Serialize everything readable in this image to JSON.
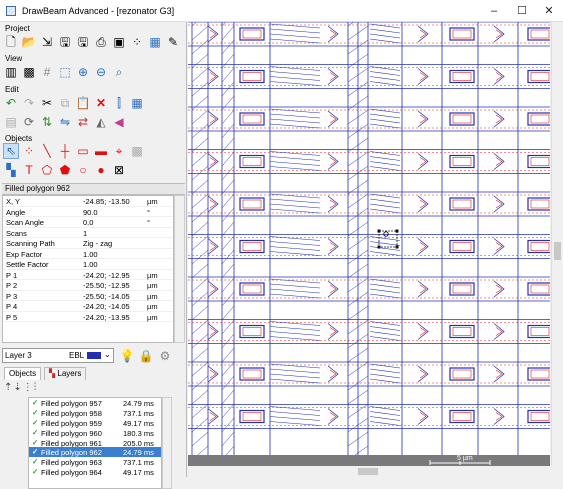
{
  "window": {
    "title": "DrawBeam Advanced - [rezonator G3]",
    "minimize": "–",
    "maximize": "☐",
    "close": "✕"
  },
  "sections": {
    "project": "Project",
    "view": "View",
    "edit": "Edit",
    "objects": "Objects"
  },
  "selected_header": "Filled polygon 962",
  "properties": [
    {
      "key": "X, Y",
      "value": "-24.85; -13.50",
      "unit": "µm"
    },
    {
      "key": "Angle",
      "value": "90.0",
      "unit": "°"
    },
    {
      "key": "Scan Angle",
      "value": "0.0",
      "unit": "°"
    },
    {
      "key": "Scans",
      "value": "1",
      "unit": ""
    },
    {
      "key": "Scanning Path",
      "value": "Zig - zag",
      "unit": ""
    },
    {
      "key": "Exp Factor",
      "value": "1.00",
      "unit": ""
    },
    {
      "key": "Settle Factor",
      "value": "1.00",
      "unit": ""
    },
    {
      "key": "P 1",
      "value": "-24.20; -12.95",
      "unit": "µm"
    },
    {
      "key": "P 2",
      "value": "-25.50; -12.95",
      "unit": "µm"
    },
    {
      "key": "P 3",
      "value": "-25.50; -14.05",
      "unit": "µm"
    },
    {
      "key": "P 4",
      "value": "-24.20; -14.05",
      "unit": "µm"
    },
    {
      "key": "P 5",
      "value": "-24.20; -13.95",
      "unit": "µm"
    }
  ],
  "layer": {
    "name": "Layer 3",
    "type": "EBL"
  },
  "tabs": {
    "objects": "Objects",
    "layers": "Layers"
  },
  "objects_list": [
    {
      "name": "Filled polygon 957",
      "time": "24.79 ms",
      "selected": false
    },
    {
      "name": "Filled polygon 958",
      "time": "737.1 ms",
      "selected": false
    },
    {
      "name": "Filled polygon 959",
      "time": "49.17 ms",
      "selected": false
    },
    {
      "name": "Filled polygon 960",
      "time": "180.3 ms",
      "selected": false
    },
    {
      "name": "Filled polygon 961",
      "time": "205.0 ms",
      "selected": false
    },
    {
      "name": "Filled polygon 962",
      "time": "24.79 ms",
      "selected": true
    },
    {
      "name": "Filled polygon 963",
      "time": "737.1 ms",
      "selected": false
    },
    {
      "name": "Filled polygon 964",
      "time": "49.17 ms",
      "selected": false
    }
  ],
  "scale_label": "5 µm",
  "colors": {
    "accent": "#3c7fd1",
    "pattern_blue": "#2430b0",
    "pattern_red": "#e02020"
  }
}
